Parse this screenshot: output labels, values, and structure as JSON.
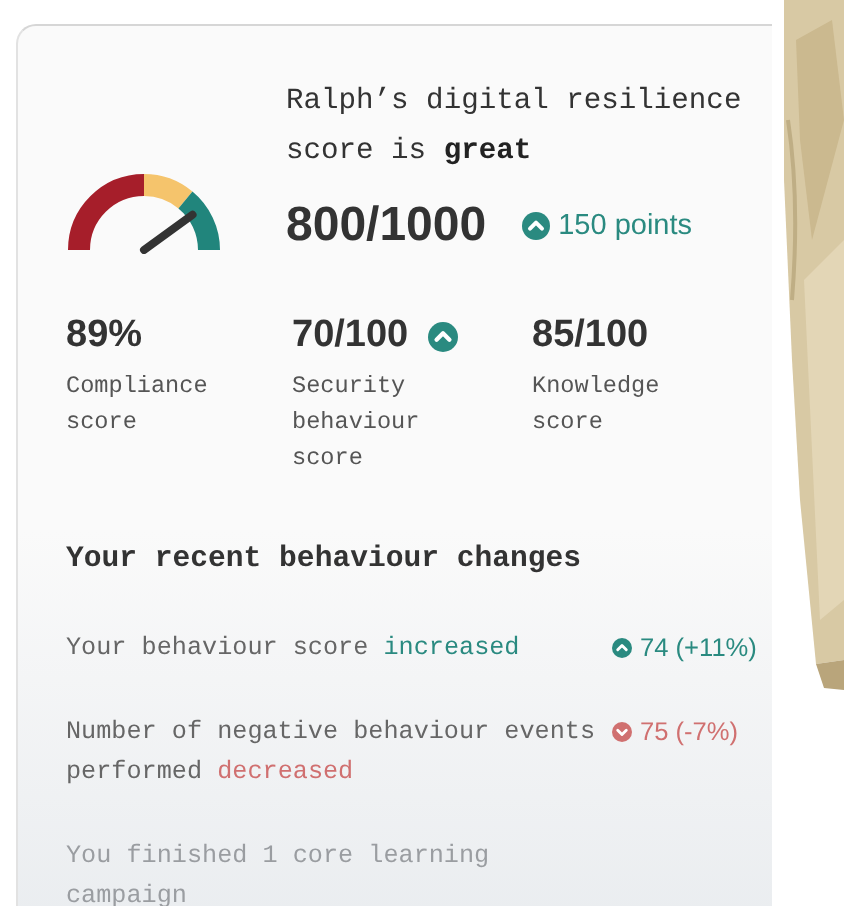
{
  "summary": {
    "title": "Ralph’s digital resilience score is **great**",
    "score": "800/1000",
    "gauge": {
      "level": 0.8
    },
    "change": {
      "improved": true,
      "text": "150 points"
    }
  },
  "stats": [
    {
      "value": "89%",
      "label": "Compliance score",
      "improved": false
    },
    {
      "value": "70/100",
      "label": "Security behaviour score",
      "improved": true
    },
    {
      "value": "85/100",
      "label": "Knowledge score",
      "improved": false
    }
  ],
  "changes": {
    "title": "Your recent behaviour changes",
    "items": [
      {
        "kind": "up",
        "text": "Your behaviour score",
        "highlight": "increased",
        "figure": "74 (+11%)",
        "dimmed": false
      },
      {
        "kind": "down",
        "text": "Number of negative behaviour events performed",
        "highlight": "decreased",
        "figure": "75 (-7%)",
        "dimmed": false
      },
      {
        "kind": "plain",
        "text": "You finished 1 core learning campaign",
        "dimmed": true
      }
    ]
  }
}
